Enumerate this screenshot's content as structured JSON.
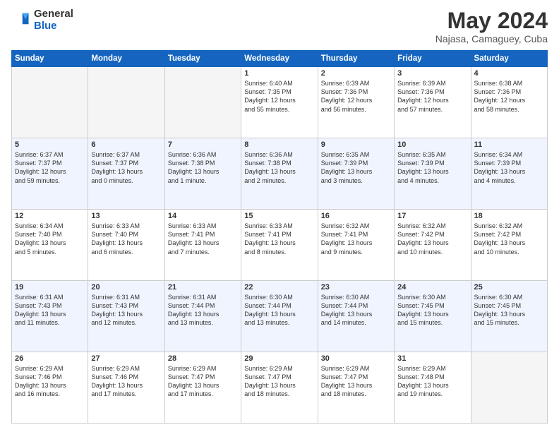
{
  "logo": {
    "general": "General",
    "blue": "Blue"
  },
  "title": "May 2024",
  "subtitle": "Najasa, Camaguey, Cuba",
  "headers": [
    "Sunday",
    "Monday",
    "Tuesday",
    "Wednesday",
    "Thursday",
    "Friday",
    "Saturday"
  ],
  "weeks": [
    [
      {
        "day": "",
        "info": "",
        "empty": true
      },
      {
        "day": "",
        "info": "",
        "empty": true
      },
      {
        "day": "",
        "info": "",
        "empty": true
      },
      {
        "day": "1",
        "info": "Sunrise: 6:40 AM\nSunset: 7:35 PM\nDaylight: 12 hours\nand 55 minutes."
      },
      {
        "day": "2",
        "info": "Sunrise: 6:39 AM\nSunset: 7:36 PM\nDaylight: 12 hours\nand 56 minutes."
      },
      {
        "day": "3",
        "info": "Sunrise: 6:39 AM\nSunset: 7:36 PM\nDaylight: 12 hours\nand 57 minutes."
      },
      {
        "day": "4",
        "info": "Sunrise: 6:38 AM\nSunset: 7:36 PM\nDaylight: 12 hours\nand 58 minutes."
      }
    ],
    [
      {
        "day": "5",
        "info": "Sunrise: 6:37 AM\nSunset: 7:37 PM\nDaylight: 12 hours\nand 59 minutes."
      },
      {
        "day": "6",
        "info": "Sunrise: 6:37 AM\nSunset: 7:37 PM\nDaylight: 13 hours\nand 0 minutes."
      },
      {
        "day": "7",
        "info": "Sunrise: 6:36 AM\nSunset: 7:38 PM\nDaylight: 13 hours\nand 1 minute."
      },
      {
        "day": "8",
        "info": "Sunrise: 6:36 AM\nSunset: 7:38 PM\nDaylight: 13 hours\nand 2 minutes."
      },
      {
        "day": "9",
        "info": "Sunrise: 6:35 AM\nSunset: 7:39 PM\nDaylight: 13 hours\nand 3 minutes."
      },
      {
        "day": "10",
        "info": "Sunrise: 6:35 AM\nSunset: 7:39 PM\nDaylight: 13 hours\nand 4 minutes."
      },
      {
        "day": "11",
        "info": "Sunrise: 6:34 AM\nSunset: 7:39 PM\nDaylight: 13 hours\nand 4 minutes."
      }
    ],
    [
      {
        "day": "12",
        "info": "Sunrise: 6:34 AM\nSunset: 7:40 PM\nDaylight: 13 hours\nand 5 minutes."
      },
      {
        "day": "13",
        "info": "Sunrise: 6:33 AM\nSunset: 7:40 PM\nDaylight: 13 hours\nand 6 minutes."
      },
      {
        "day": "14",
        "info": "Sunrise: 6:33 AM\nSunset: 7:41 PM\nDaylight: 13 hours\nand 7 minutes."
      },
      {
        "day": "15",
        "info": "Sunrise: 6:33 AM\nSunset: 7:41 PM\nDaylight: 13 hours\nand 8 minutes."
      },
      {
        "day": "16",
        "info": "Sunrise: 6:32 AM\nSunset: 7:41 PM\nDaylight: 13 hours\nand 9 minutes."
      },
      {
        "day": "17",
        "info": "Sunrise: 6:32 AM\nSunset: 7:42 PM\nDaylight: 13 hours\nand 10 minutes."
      },
      {
        "day": "18",
        "info": "Sunrise: 6:32 AM\nSunset: 7:42 PM\nDaylight: 13 hours\nand 10 minutes."
      }
    ],
    [
      {
        "day": "19",
        "info": "Sunrise: 6:31 AM\nSunset: 7:43 PM\nDaylight: 13 hours\nand 11 minutes."
      },
      {
        "day": "20",
        "info": "Sunrise: 6:31 AM\nSunset: 7:43 PM\nDaylight: 13 hours\nand 12 minutes."
      },
      {
        "day": "21",
        "info": "Sunrise: 6:31 AM\nSunset: 7:44 PM\nDaylight: 13 hours\nand 13 minutes."
      },
      {
        "day": "22",
        "info": "Sunrise: 6:30 AM\nSunset: 7:44 PM\nDaylight: 13 hours\nand 13 minutes."
      },
      {
        "day": "23",
        "info": "Sunrise: 6:30 AM\nSunset: 7:44 PM\nDaylight: 13 hours\nand 14 minutes."
      },
      {
        "day": "24",
        "info": "Sunrise: 6:30 AM\nSunset: 7:45 PM\nDaylight: 13 hours\nand 15 minutes."
      },
      {
        "day": "25",
        "info": "Sunrise: 6:30 AM\nSunset: 7:45 PM\nDaylight: 13 hours\nand 15 minutes."
      }
    ],
    [
      {
        "day": "26",
        "info": "Sunrise: 6:29 AM\nSunset: 7:46 PM\nDaylight: 13 hours\nand 16 minutes."
      },
      {
        "day": "27",
        "info": "Sunrise: 6:29 AM\nSunset: 7:46 PM\nDaylight: 13 hours\nand 17 minutes."
      },
      {
        "day": "28",
        "info": "Sunrise: 6:29 AM\nSunset: 7:47 PM\nDaylight: 13 hours\nand 17 minutes."
      },
      {
        "day": "29",
        "info": "Sunrise: 6:29 AM\nSunset: 7:47 PM\nDaylight: 13 hours\nand 18 minutes."
      },
      {
        "day": "30",
        "info": "Sunrise: 6:29 AM\nSunset: 7:47 PM\nDaylight: 13 hours\nand 18 minutes."
      },
      {
        "day": "31",
        "info": "Sunrise: 6:29 AM\nSunset: 7:48 PM\nDaylight: 13 hours\nand 19 minutes."
      },
      {
        "day": "",
        "info": "",
        "empty": true
      }
    ]
  ]
}
